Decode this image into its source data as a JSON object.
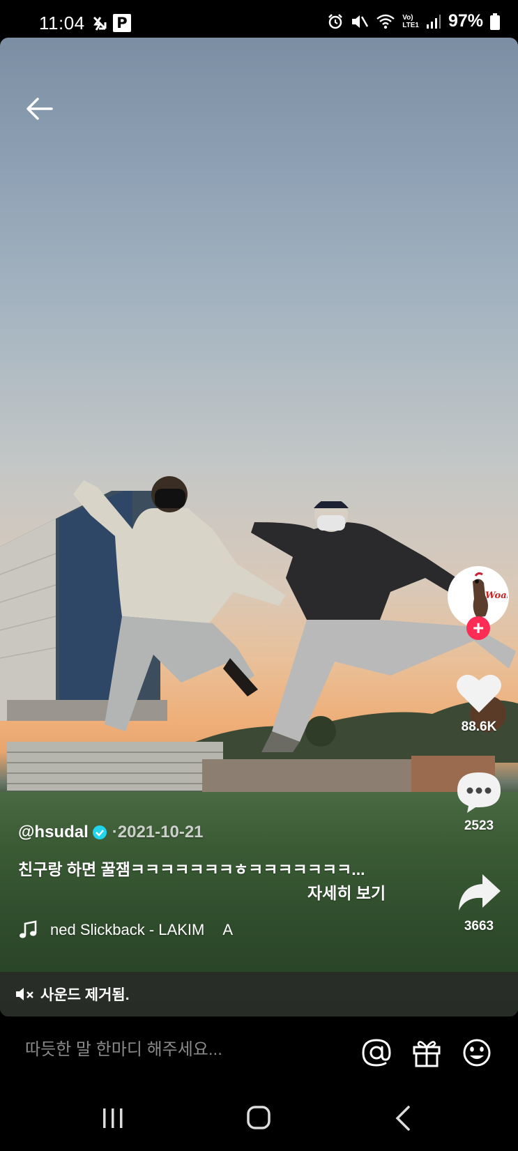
{
  "status_bar": {
    "time": "11:04",
    "battery": "97%",
    "app_badge": "P",
    "network_label_top": "Vo)",
    "network_label_bottom": "LTE1"
  },
  "video": {
    "author": "@hsudal",
    "date_separator": " · ",
    "date": "2021-10-21",
    "caption": "친구랑 하면 꿀잼ㅋㅋㅋㅋㅋㅋㅋㅎㅋㅋㅋㅋㅋㅋㅋ...",
    "see_more": "자세히 보기",
    "music": "ned Slickback - LAKIM",
    "music_tail": "A",
    "avatar_text": "Woah"
  },
  "actions": {
    "follow": "+",
    "likes": "88.6K",
    "comments": "2523",
    "shares": "3663"
  },
  "sound_banner": {
    "text": "사운드 제거됨."
  },
  "comment_bar": {
    "placeholder": "따듯한 말 한마디 해주세요..."
  },
  "colors": {
    "accent": "#fe2c55",
    "verified": "#20d5ec"
  }
}
